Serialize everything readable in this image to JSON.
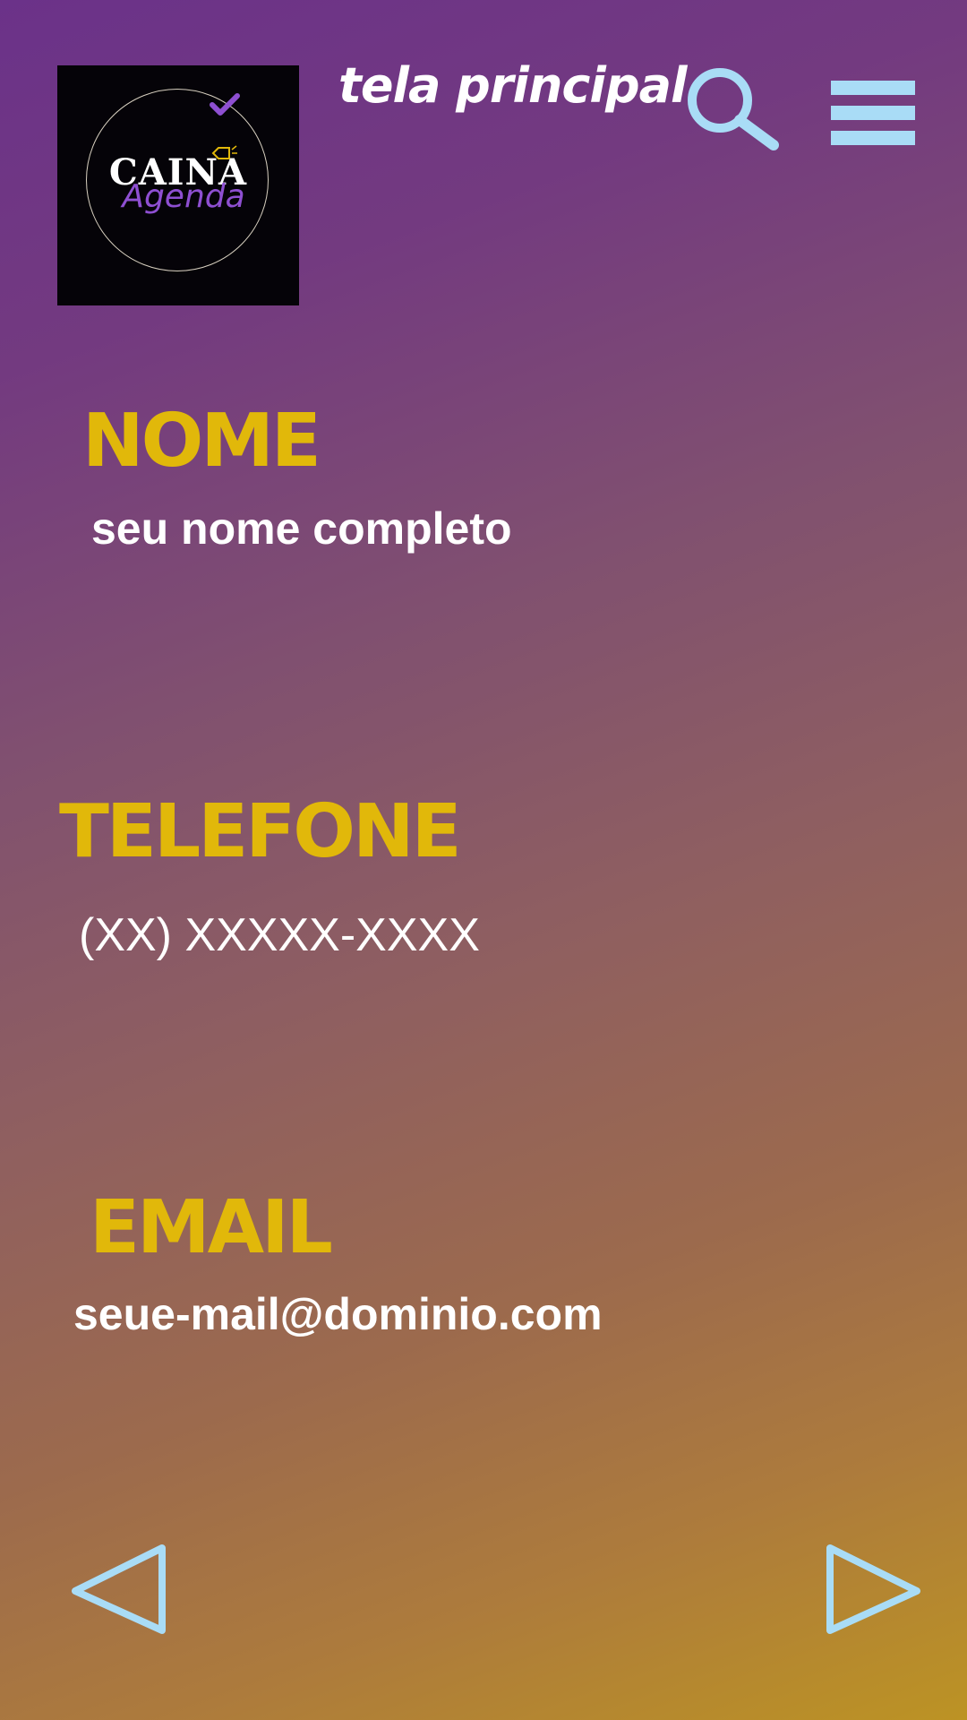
{
  "header": {
    "logo": {
      "brand_top": "CAINA",
      "brand_bottom": "Agenda"
    },
    "title": "tela principal",
    "search_icon": "search-icon",
    "menu_icon": "hamburger-menu-icon"
  },
  "form": {
    "nome": {
      "label": "NOME",
      "value": "seu nome completo"
    },
    "telefone": {
      "label": "TELEFONE",
      "value": "(XX) XXXXX-XXXX"
    },
    "email": {
      "label": "EMAIL",
      "value": "seue-mail@dominio.com"
    }
  },
  "navigation": {
    "prev_icon": "triangle-left-icon",
    "next_icon": "triangle-right-icon"
  },
  "colors": {
    "label": "#e1b80a",
    "value": "#ffffff",
    "icon": "#a9dcf6",
    "gradient_top": "#6b3289",
    "gradient_bottom": "#bc9324"
  }
}
